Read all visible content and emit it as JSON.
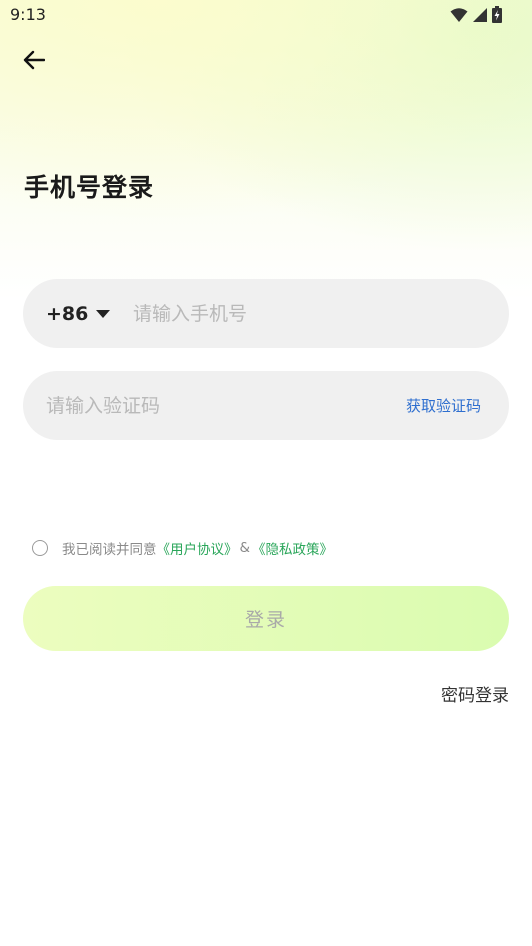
{
  "status_bar": {
    "time": "9:13",
    "icons": [
      "wifi-icon",
      "signal-icon",
      "battery-charging-icon"
    ]
  },
  "header": {
    "back_icon": "arrow-left-icon"
  },
  "title": "手机号登录",
  "phone_field": {
    "country_code": "+86",
    "dropdown_icon": "caret-down-icon",
    "placeholder": "请输入手机号",
    "value": ""
  },
  "code_field": {
    "placeholder": "请输入验证码",
    "value": "",
    "get_code_label": "获取验证码"
  },
  "agreement": {
    "checked": false,
    "prefix": "我已阅读并同意",
    "user_agreement": "《用户协议》",
    "amp": "&",
    "privacy_policy": "《隐私政策》"
  },
  "login_button": {
    "label": "登录"
  },
  "password_login": {
    "label": "密码登录"
  },
  "colors": {
    "accent_green": "#2aa65a",
    "link_blue": "#2f6fcf",
    "login_button_bg": "#e3fcb8",
    "field_bg": "#f0f0f0"
  }
}
